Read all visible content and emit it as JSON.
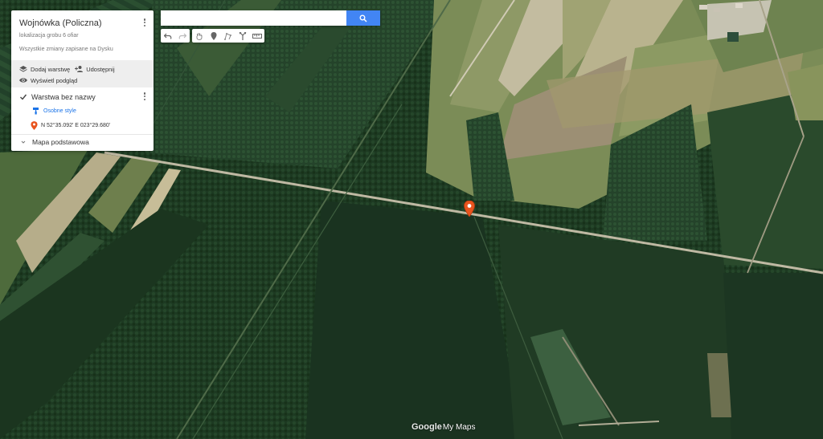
{
  "map": {
    "title": "Wojnówka (Policzna)",
    "subtitle": "lokalizacja grobu 6 ofiar",
    "saved_status": "Wszystkie zmiany zapisane na Dysku",
    "actions": {
      "add_layer": "Dodaj warstwę",
      "share": "Udostępnij",
      "preview": "Wyświetl podgląd"
    },
    "layer": {
      "name": "Warstwa bez nazwy",
      "style_link": "Osobne style",
      "point_label": "N 52°35.092' E 023°29.680'"
    },
    "base_map": "Mapa podstawowa"
  },
  "search": {
    "value": "",
    "placeholder": ""
  },
  "logo": {
    "google": "Google",
    "mymaps": "My Maps"
  },
  "colors": {
    "accent_blue": "#4285f4",
    "marker": "#e8541e",
    "link": "#1a73e8"
  },
  "icons": [
    "kebab-menu-icon",
    "layers-icon",
    "add-person-icon",
    "eye-icon",
    "checkbox-icon",
    "paint-roller-icon",
    "pin-icon",
    "search-icon",
    "undo-icon",
    "redo-icon",
    "hand-icon",
    "marker-icon",
    "polygon-icon",
    "route-icon",
    "ruler-icon",
    "chevron-icon"
  ]
}
